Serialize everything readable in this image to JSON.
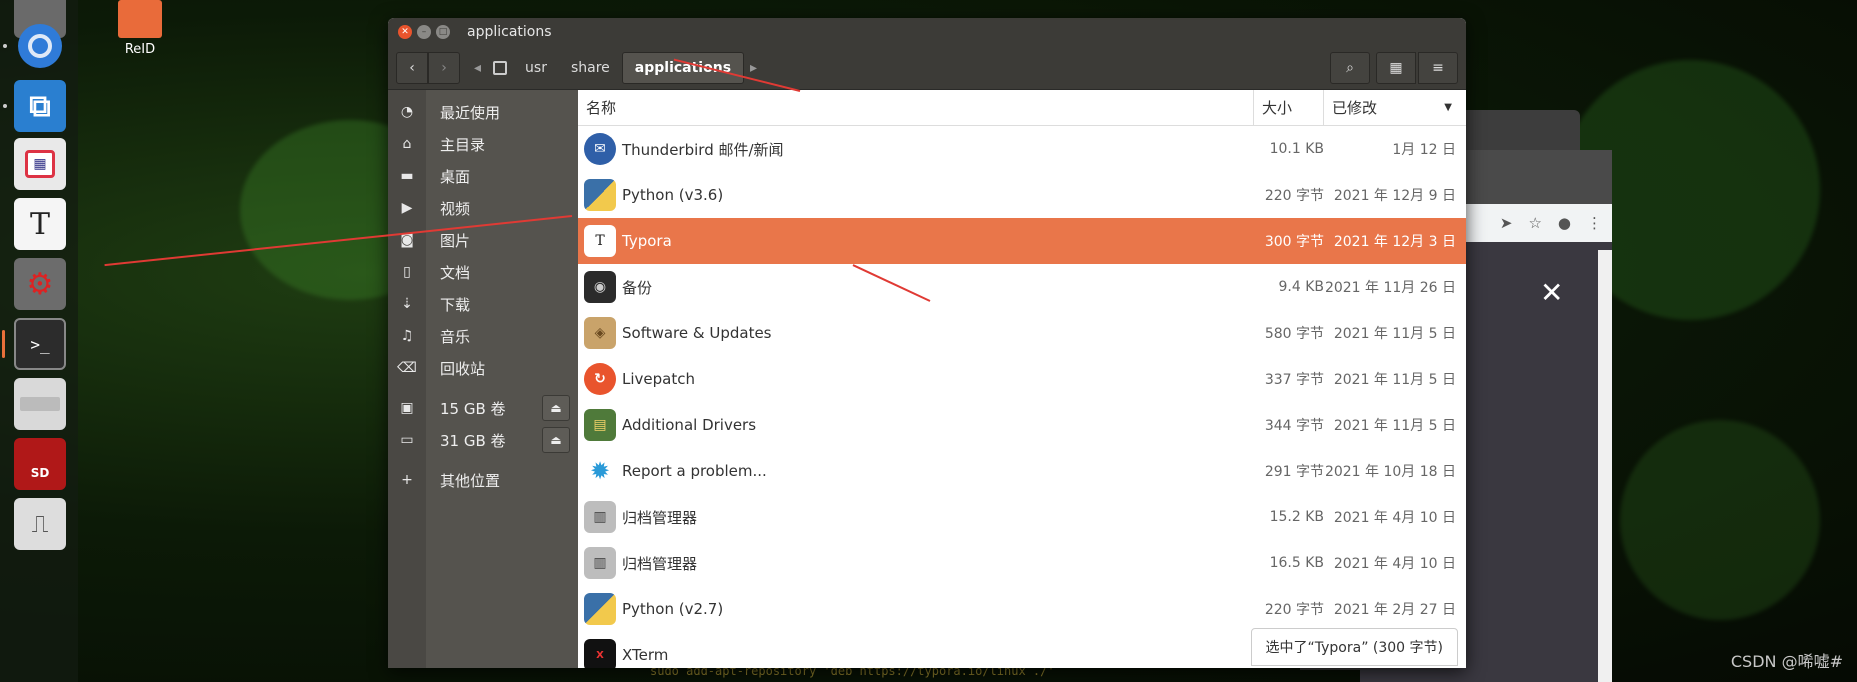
{
  "desktop": {
    "icon_label": "ReID",
    "watermark": "CSDN @唏嘘#"
  },
  "window": {
    "title": "applications"
  },
  "breadcrumbs": [
    "usr",
    "share",
    "applications"
  ],
  "sidebar": {
    "items": [
      {
        "label": "最近使用",
        "icon": "clock-icon"
      },
      {
        "label": "主目录",
        "icon": "home-icon"
      },
      {
        "label": "桌面",
        "icon": "folder-icon"
      },
      {
        "label": "视频",
        "icon": "video-icon"
      },
      {
        "label": "图片",
        "icon": "camera-icon"
      },
      {
        "label": "文档",
        "icon": "document-icon"
      },
      {
        "label": "下载",
        "icon": "download-icon"
      },
      {
        "label": "音乐",
        "icon": "music-icon"
      },
      {
        "label": "回收站",
        "icon": "trash-icon"
      }
    ],
    "volumes": [
      {
        "label": "15 GB 卷"
      },
      {
        "label": "31 GB 卷"
      }
    ],
    "other": "其他位置"
  },
  "columns": {
    "name": "名称",
    "size": "大小",
    "modified": "已修改"
  },
  "files": [
    {
      "name": "Thunderbird 邮件/新闻",
      "size": "10.1 KB",
      "date": "1月 12 日",
      "icon": "thunderbird-icon"
    },
    {
      "name": "Python (v3.6)",
      "size": "220 字节",
      "date": "2021 年 12月 9 日",
      "icon": "python-icon"
    },
    {
      "name": "Typora",
      "size": "300 字节",
      "date": "2021 年 12月 3 日",
      "icon": "typora-icon",
      "selected": true
    },
    {
      "name": "备份",
      "size": "9.4 KB",
      "date": "2021 年 11月 26 日",
      "icon": "backup-icon"
    },
    {
      "name": "Software & Updates",
      "size": "580 字节",
      "date": "2021 年 11月 5 日",
      "icon": "software-updates-icon"
    },
    {
      "name": "Livepatch",
      "size": "337 字节",
      "date": "2021 年 11月 5 日",
      "icon": "livepatch-icon"
    },
    {
      "name": "Additional Drivers",
      "size": "344 字节",
      "date": "2021 年 11月 5 日",
      "icon": "drivers-icon"
    },
    {
      "name": "Report a problem...",
      "size": "291 字节",
      "date": "2021 年 10月 18 日",
      "icon": "report-icon"
    },
    {
      "name": "归档管理器",
      "size": "15.2 KB",
      "date": "2021 年 4月 10 日",
      "icon": "archive-icon"
    },
    {
      "name": "归档管理器",
      "size": "16.5 KB",
      "date": "2021 年 4月 10 日",
      "icon": "archive-icon"
    },
    {
      "name": "Python (v2.7)",
      "size": "220 字节",
      "date": "2021 年 2月 27 日",
      "icon": "python-icon"
    },
    {
      "name": "XTerm",
      "size": "",
      "date": "",
      "icon": "xterm-icon"
    }
  ],
  "status": "选中了“Typora” (300 字节)",
  "launcher": {
    "typora_letter": "T"
  },
  "bg_window": {
    "close": "✕",
    "terminal_text": "sudo add-apt-repository 'deb https://typora.io/linux ./'"
  }
}
